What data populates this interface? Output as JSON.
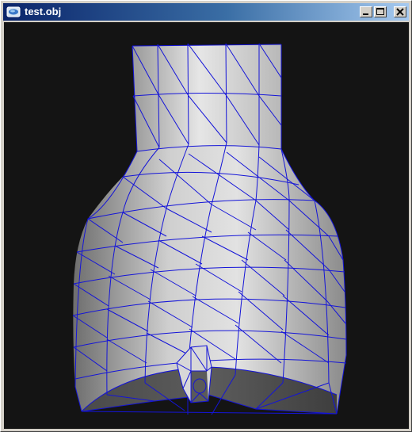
{
  "window": {
    "title": "test.obj",
    "icons": {
      "app": "obj-viewer-icon",
      "minimize": "minimize-icon",
      "maximize": "maximize-icon",
      "close": "close-icon"
    }
  },
  "viewport": {
    "background": "#141414",
    "mesh_fill_light": "#e8e8e8",
    "mesh_fill_dark": "#6a6a6a",
    "wire_color": "#1414d8",
    "render_mode": "shaded-wireframe"
  }
}
